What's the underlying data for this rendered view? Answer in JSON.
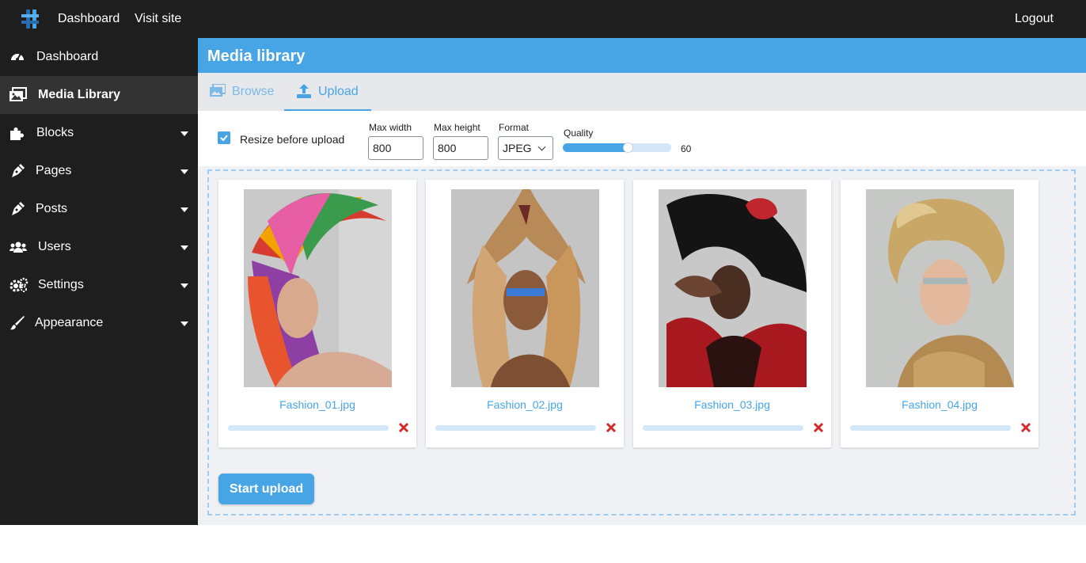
{
  "topbar": {
    "logo_icon": "hashtag-logo-icon",
    "dashboard": "Dashboard",
    "visit_site": "Visit site",
    "logout": "Logout"
  },
  "sidebar": {
    "items": [
      {
        "label": "Dashboard",
        "icon": "gauge-icon",
        "active": false,
        "has_submenu": false
      },
      {
        "label": "Media Library",
        "icon": "images-icon",
        "active": true,
        "has_submenu": false
      },
      {
        "label": "Blocks",
        "icon": "puzzle-icon",
        "active": false,
        "has_submenu": true
      },
      {
        "label": "Pages",
        "icon": "pen-nib-icon",
        "active": false,
        "has_submenu": true
      },
      {
        "label": "Posts",
        "icon": "pen-nib-icon",
        "active": false,
        "has_submenu": true
      },
      {
        "label": "Users",
        "icon": "users-icon",
        "active": false,
        "has_submenu": true
      },
      {
        "label": "Settings",
        "icon": "gears-icon",
        "active": false,
        "has_submenu": true
      },
      {
        "label": "Appearance",
        "icon": "brush-icon",
        "active": false,
        "has_submenu": true
      }
    ]
  },
  "header": {
    "title": "Media library"
  },
  "tabs": [
    {
      "label": "Browse",
      "icon": "image-icon",
      "active": false
    },
    {
      "label": "Upload",
      "icon": "upload-icon",
      "active": true
    }
  ],
  "options": {
    "resize_label": "Resize before upload",
    "resize_checked": true,
    "max_width_label": "Max width",
    "max_width_value": "800",
    "max_height_label": "Max height",
    "max_height_value": "800",
    "format_label": "Format",
    "format_value": "JPEG",
    "quality_label": "Quality",
    "quality_value": "60",
    "quality_level": 0.6
  },
  "files": [
    {
      "name": "Fashion_01.jpg",
      "progress": 0
    },
    {
      "name": "Fashion_02.jpg",
      "progress": 0
    },
    {
      "name": "Fashion_03.jpg",
      "progress": 0
    },
    {
      "name": "Fashion_04.jpg",
      "progress": 0
    }
  ],
  "actions": {
    "start_upload": "Start upload"
  },
  "colors": {
    "accent": "#47a5e6",
    "sidebar_bg": "#1e1e1e",
    "remove": "#d42a2a"
  }
}
